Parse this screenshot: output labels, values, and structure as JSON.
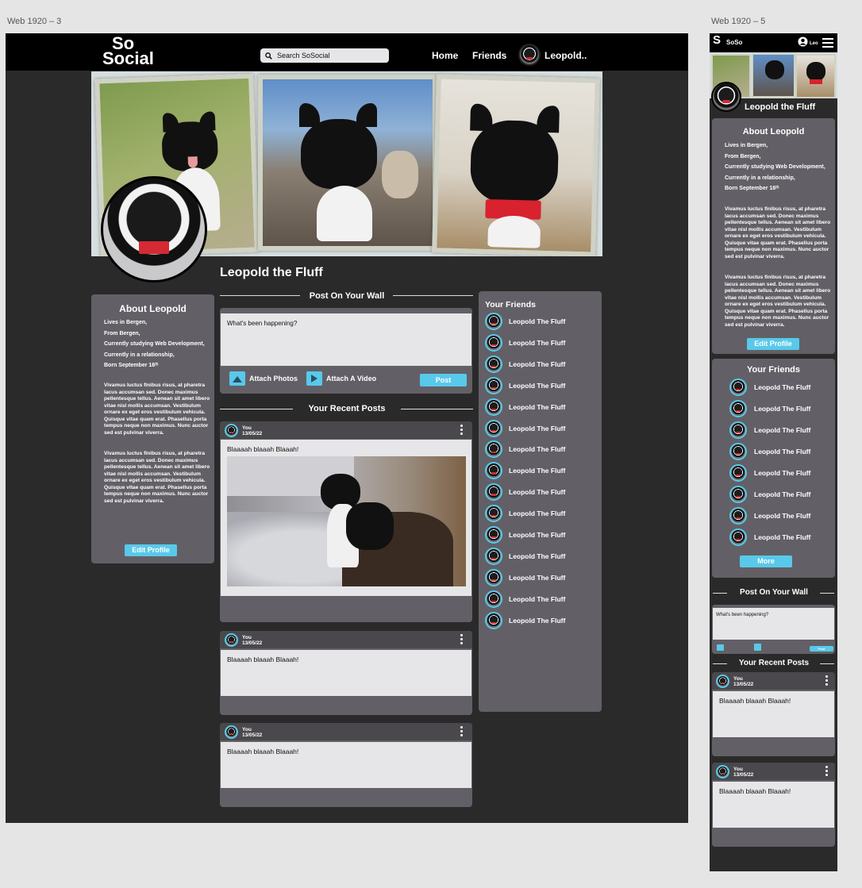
{
  "artboards": {
    "desktop_label": "Web 1920 – 3",
    "mobile_label": "Web 1920 – 5"
  },
  "brand": {
    "logo_line1": "So",
    "logo_line2": "Social",
    "logo_short": "SoSo"
  },
  "search": {
    "placeholder": "Search SoSocial"
  },
  "nav": {
    "home": "Home",
    "friends": "Friends",
    "profile": "Leopold..",
    "profile_short": "Leo"
  },
  "profile": {
    "name": "Leopold the Fluff"
  },
  "about": {
    "title": "About Leopold",
    "facts": [
      "Lives in Bergen,",
      "From Bergen,",
      "Currently studying Web Development,",
      "Currently in a relationship,",
      "Born September 16ᵗʰ"
    ],
    "paragraphs": [
      "Vivamus luctus finibus risus, at pharetra lacus accumsan sed. Donec maximus pellentesque tellus. Aenean sit amet libero vitae nisl mollis accumsan. Vestibulum ornare ex eget eros vestibulum vehicula. Quisque vitae quam erat. Phasellus porta tempus neque non maximus. Nunc auctor sed est pulvinar viverra.",
      "Vivamus luctus finibus risus, at pharetra lacus accumsan sed. Donec maximus pellentesque tellus. Aenean sit amet libero vitae nisl mollis accumsan. Vestibulum ornare ex eget eros vestibulum vehicula. Quisque vitae quam erat. Phasellus porta tempus neque non maximus. Nunc auctor sed est pulvinar viverra."
    ],
    "edit_button": "Edit Profile"
  },
  "wall": {
    "title": "Post On Your Wall",
    "placeholder": "What's been happening?",
    "attach_photos": "Attach Photos",
    "attach_video": "Attach A Video",
    "post_button": "Post"
  },
  "recent": {
    "title": "Your Recent Posts",
    "posts": [
      {
        "author": "You",
        "date": "13/05/22",
        "text": "Blaaaah blaaah Blaaah!"
      },
      {
        "author": "You",
        "date": "13/05/22",
        "text": "Blaaaah blaaah Blaaah!"
      },
      {
        "author": "You",
        "date": "13/05/22",
        "text": "Blaaaah blaaah Blaaah!"
      }
    ]
  },
  "friends": {
    "title": "Your Friends",
    "names": [
      "Leopold The Fluff",
      "Leopold The Fluff",
      "Leopold The Fluff",
      "Leopold The Fluff",
      "Leopold The Fluff",
      "Leopold The Fluff",
      "Leopold The Fluff",
      "Leopold The Fluff",
      "Leopold The Fluff",
      "Leopold The Fluff",
      "Leopold The Fluff",
      "Leopold The Fluff",
      "Leopold The Fluff",
      "Leopold The Fluff",
      "Leopold The Fluff"
    ],
    "mobile_names": [
      "Leopold The Fluff",
      "Leopold The Fluff",
      "Leopold The Fluff",
      "Leopold The Fluff",
      "Leopold The Fluff",
      "Leopold The Fluff",
      "Leopold The Fluff",
      "Leopold The Fluff"
    ],
    "more_button": "More"
  },
  "colors": {
    "accent": "#58c9ea",
    "panel": "#626066",
    "background": "#2a2a2a",
    "topbar": "#000000",
    "canvas": "#e5e5e5"
  }
}
